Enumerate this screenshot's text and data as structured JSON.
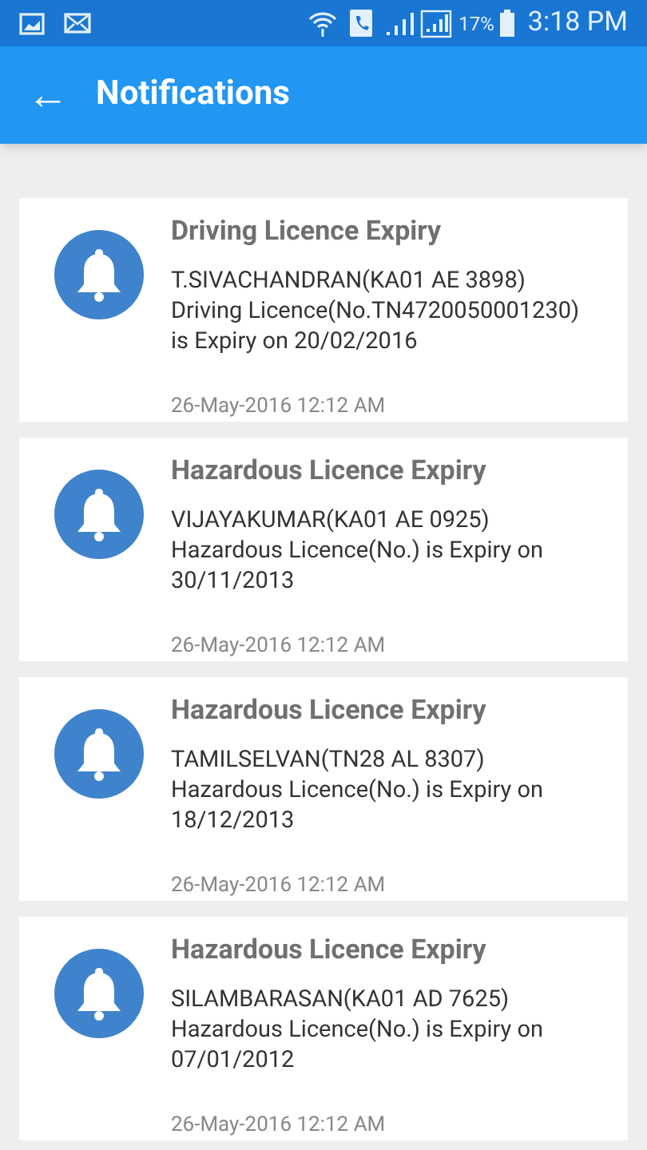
{
  "status_bar": {
    "battery": "17%",
    "time": "3:18 PM"
  },
  "app_bar": {
    "back": "←",
    "title": "Notifications"
  },
  "notifications": [
    {
      "title": "Driving Licence Expiry",
      "lines": [
        "T.SIVACHANDRAN(KA01 AE 3898)",
        "Driving Licence(No.TN4720050001230)",
        "is Expiry on 20/02/2016"
      ],
      "time": "26-May-2016 12:12 AM"
    },
    {
      "title": "Hazardous Licence Expiry",
      "lines": [
        "VIJAYAKUMAR(KA01 AE 0925)",
        "Hazardous Licence(No.) is Expiry on",
        "30/11/2013"
      ],
      "time": "26-May-2016 12:12 AM"
    },
    {
      "title": "Hazardous Licence Expiry",
      "lines": [
        "TAMILSELVAN(TN28 AL 8307)",
        "Hazardous Licence(No.) is Expiry on",
        "18/12/2013"
      ],
      "time": "26-May-2016 12:12 AM"
    },
    {
      "title": "Hazardous Licence Expiry",
      "lines": [
        "SILAMBARASAN(KA01 AD 7625)",
        "Hazardous Licence(No.) is Expiry on",
        "07/01/2012"
      ],
      "time": "26-May-2016 12:12 AM"
    }
  ]
}
